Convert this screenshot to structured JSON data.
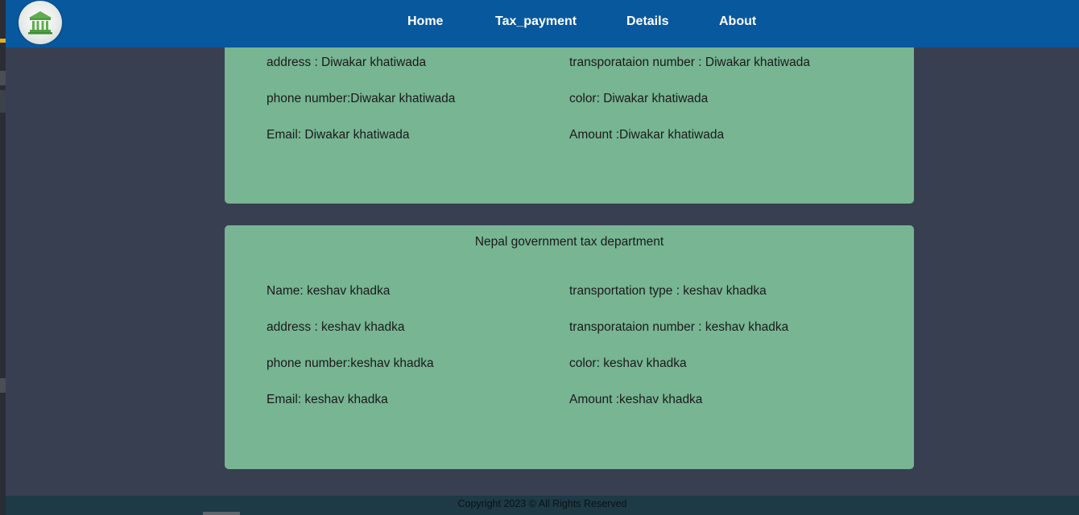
{
  "nav": {
    "logo_icon": "government-building-icon",
    "links": [
      "Home",
      "Tax_payment",
      "Details",
      "About"
    ]
  },
  "cards": [
    {
      "title": "",
      "left_fields": {
        "address": "address : Diwakar khatiwada",
        "phone": "phone number:Diwakar khatiwada",
        "email": "Email: Diwakar khatiwada"
      },
      "right_fields": {
        "transport_number": "transporataion number : Diwakar khatiwada",
        "color": "color: Diwakar khatiwada",
        "amount": "Amount :Diwakar khatiwada"
      }
    },
    {
      "title": "Nepal government tax department",
      "left_fields": {
        "name": "Name: keshav khadka",
        "address": "address : keshav khadka",
        "phone": "phone number:keshav khadka",
        "email": "Email: keshav khadka"
      },
      "right_fields": {
        "transport_type": "transportation type : keshav khadka",
        "transport_number": "transporataion number : keshav khadka",
        "color": "color: keshav khadka",
        "amount": "Amount :keshav khadka"
      }
    }
  ],
  "footer": {
    "text": "Copyright 2023 © All Rights Reserved"
  },
  "colors": {
    "navbar": "#08589e",
    "background": "#383f51",
    "card": "#77b593",
    "footer": "#1d3a46"
  }
}
